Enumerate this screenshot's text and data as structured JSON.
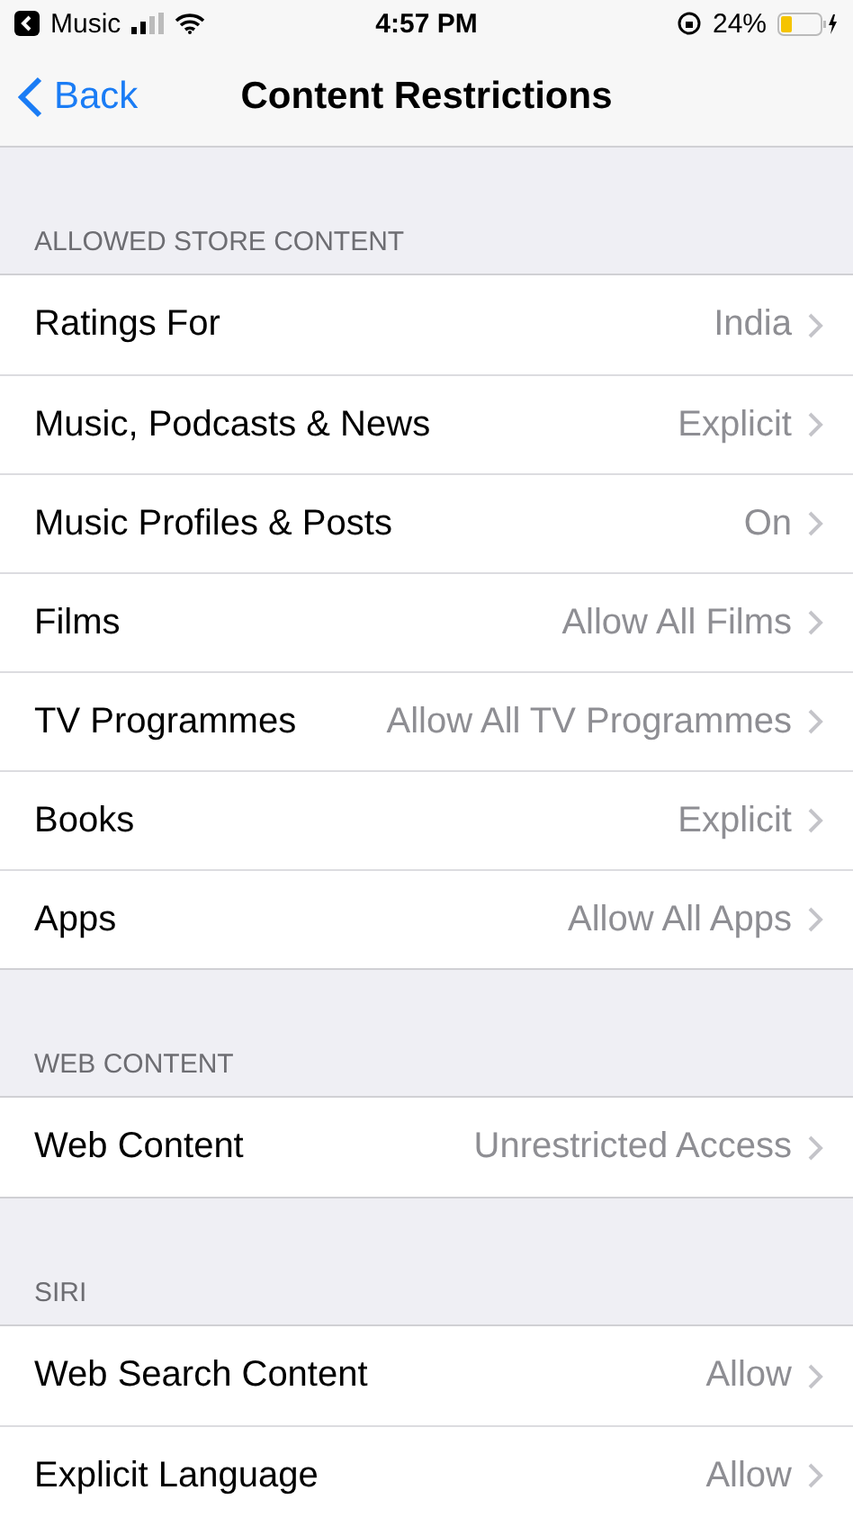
{
  "status_bar": {
    "back_app": "Music",
    "time": "4:57 PM",
    "battery": "24%"
  },
  "nav": {
    "back": "Back",
    "title": "Content Restrictions"
  },
  "sections": [
    {
      "header": "ALLOWED STORE CONTENT",
      "rows": [
        {
          "label": "Ratings For",
          "value": "India"
        },
        {
          "label": "Music, Podcasts & News",
          "value": "Explicit"
        },
        {
          "label": "Music Profiles & Posts",
          "value": "On"
        },
        {
          "label": "Films",
          "value": "Allow All Films"
        },
        {
          "label": "TV Programmes",
          "value": "Allow All TV Programmes"
        },
        {
          "label": "Books",
          "value": "Explicit"
        },
        {
          "label": "Apps",
          "value": "Allow All Apps"
        }
      ]
    },
    {
      "header": "WEB CONTENT",
      "rows": [
        {
          "label": "Web Content",
          "value": "Unrestricted Access"
        }
      ]
    },
    {
      "header": "SIRI",
      "rows": [
        {
          "label": "Web Search Content",
          "value": "Allow"
        },
        {
          "label": "Explicit Language",
          "value": "Allow"
        }
      ]
    }
  ]
}
